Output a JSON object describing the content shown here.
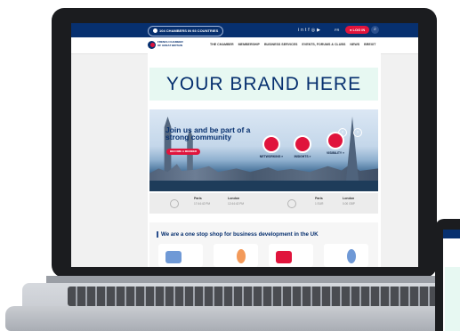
{
  "topbar": {
    "chambers_pill": "104 CHAMBERS IN 93 COUNTRIES",
    "social_icons": [
      "linkedin-icon",
      "twitter-icon",
      "facebook-icon",
      "instagram-icon",
      "youtube-icon"
    ],
    "language": "FR",
    "login": "LOG IN"
  },
  "nav": {
    "logo_text": "FRENCH CHAMBER OF GREAT BRITAIN",
    "links": [
      "THE CHAMBER",
      "MEMBERSHIP",
      "BUSINESS SERVICES",
      "EVENTS, FORUMS & CLUBS",
      "NEWS",
      "BREXIT"
    ]
  },
  "brand_banner": "YOUR BRAND HERE",
  "hero": {
    "title": "Join us and be part of a strong community",
    "cta": "BECOME A MEMBER",
    "features": [
      "NETWORKING",
      "INSIGHTS",
      "VISIBILITY"
    ],
    "feature_suffix": "»"
  },
  "info_strip": {
    "paris_label": "Paris",
    "paris_time": "17:44:42 PM",
    "london_label": "London",
    "london_time": "12:44:42 PM",
    "paris_rate_label": "Paris",
    "paris_rate": "1 EUR",
    "london_rate_label": "London",
    "london_rate": "0.00 GBP"
  },
  "services": {
    "title": "We are a one stop shop for business development in the UK"
  },
  "colors": {
    "navy": "#07306f",
    "red": "#e0143c",
    "mint": "#e7f8f2"
  }
}
